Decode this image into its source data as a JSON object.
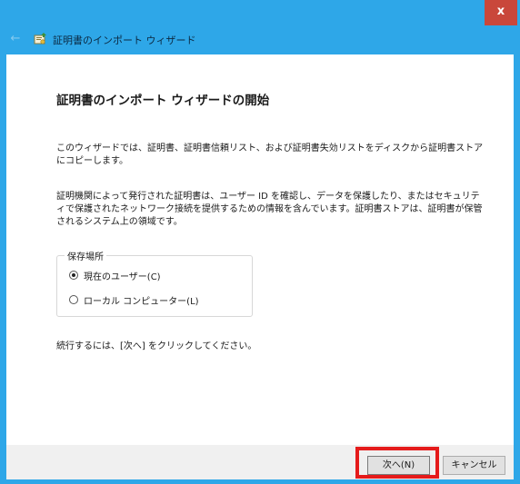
{
  "window": {
    "close_label": "x"
  },
  "nav": {
    "title": "証明書のインポート ウィザード"
  },
  "content": {
    "heading": "証明書のインポート ウィザードの開始",
    "intro": "このウィザードでは、証明書、証明書信頼リスト、および証明書失効リストをディスクから証明書ストアにコピーします。",
    "description": "証明機関によって発行された証明書は、ユーザー ID を確認し、データを保護したり、またはセキュリティで保護されたネットワーク接続を提供するための情報を含んでいます。証明書ストアは、証明書が保管されるシステム上の領域です。",
    "store_location": {
      "legend": "保存場所",
      "options": [
        {
          "label": "現在のユーザー(C)",
          "selected": true
        },
        {
          "label": "ローカル コンピューター(L)",
          "selected": false
        }
      ]
    },
    "continue_text": "続行するには、[次へ] をクリックしてください。"
  },
  "footer": {
    "next_label": "次へ(N)",
    "cancel_label": "キャンセル"
  },
  "colors": {
    "frame": "#2ea7e8",
    "close": "#c9473b",
    "highlight": "#e51b1b"
  },
  "icons": {
    "back": "back-arrow-icon",
    "wizard": "certificate-wizard-icon",
    "close": "close-icon"
  }
}
